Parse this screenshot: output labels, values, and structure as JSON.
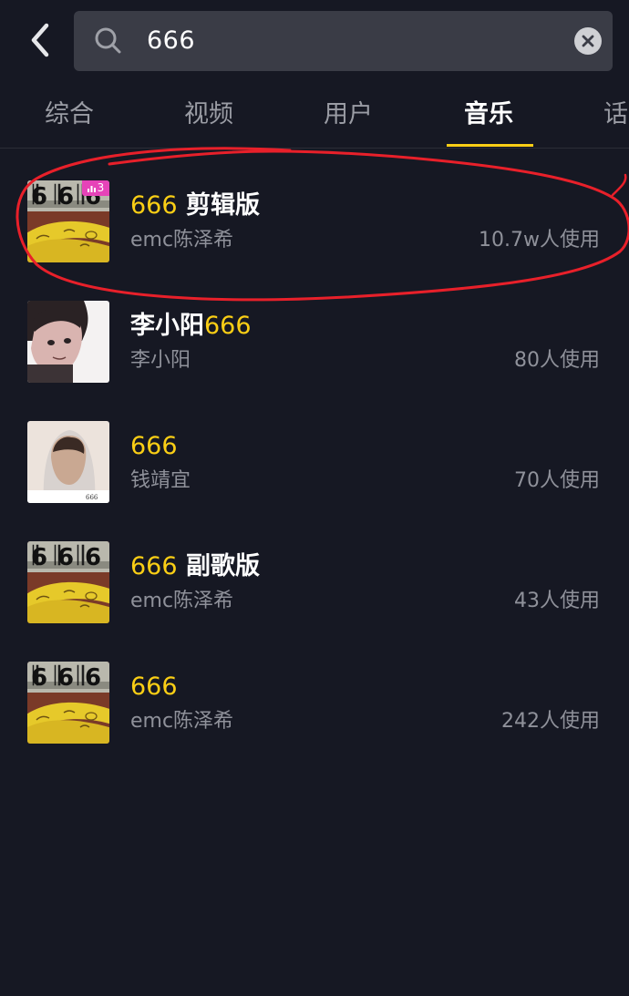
{
  "search": {
    "query": "666"
  },
  "tabs": [
    {
      "label": "综合",
      "active": false
    },
    {
      "label": "视频",
      "active": false
    },
    {
      "label": "用户",
      "active": false
    },
    {
      "label": "音乐",
      "active": true
    },
    {
      "label": "话",
      "active": false
    }
  ],
  "results": [
    {
      "title_highlight": "666",
      "title_rest": " 剪辑版",
      "artist": "emc陈泽希",
      "usage": "10.7w人使用",
      "rank_badge": "3",
      "cover": "banana-666-cover"
    },
    {
      "title_prefix": "李小阳",
      "title_highlight": "666",
      "artist": "李小阳",
      "usage": "80人使用",
      "cover": "anime-boy-cover"
    },
    {
      "title_highlight": "666",
      "artist": "钱靖宜",
      "usage": "70人使用",
      "cover": "hooded-portrait-cover"
    },
    {
      "title_highlight": "666",
      "title_rest": " 副歌版",
      "artist": "emc陈泽希",
      "usage": "43人使用",
      "cover": "banana-666-cover"
    },
    {
      "title_highlight": "666",
      "artist": "emc陈泽希",
      "usage": "242人使用",
      "cover": "banana-666-cover"
    }
  ],
  "colors": {
    "background": "#161823",
    "search_box": "#3a3c46",
    "highlight": "#face15",
    "secondary_text": "#8f919a",
    "annotation_circle": "#e8202a",
    "rank_badge": "#e643b8"
  },
  "icons": {
    "back": "chevron-left-icon",
    "search": "search-icon",
    "clear": "clear-icon",
    "rank": "bar-chart-icon"
  }
}
